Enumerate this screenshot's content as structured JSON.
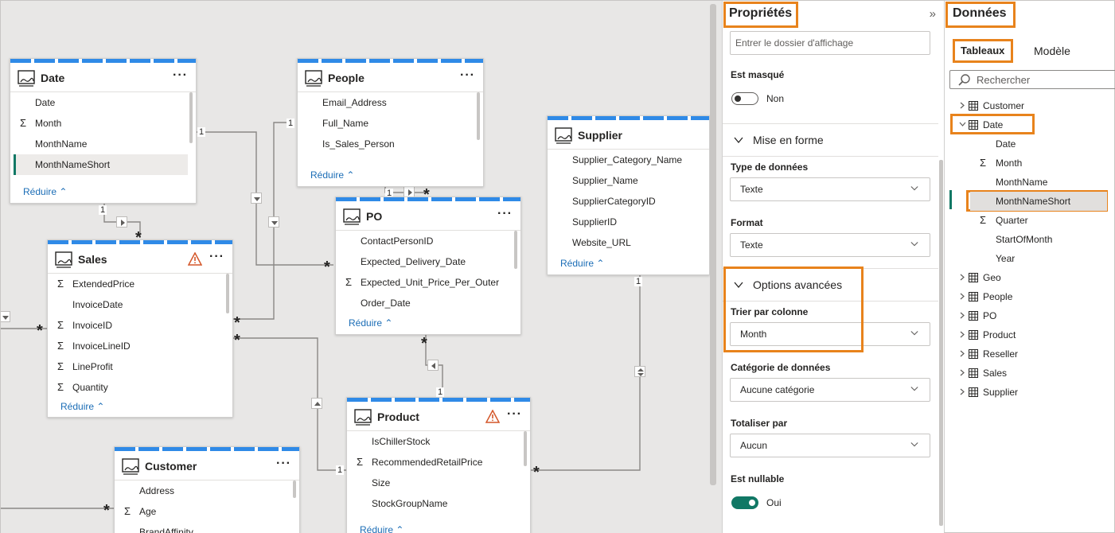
{
  "model": {
    "tables": {
      "date": {
        "name": "Date",
        "fields": [
          {
            "label": "Date",
            "sum": false
          },
          {
            "label": "Month",
            "sum": true
          },
          {
            "label": "MonthName",
            "sum": false
          },
          {
            "label": "MonthNameShort",
            "sum": false,
            "selected": true
          }
        ],
        "reduce": "Réduire"
      },
      "people": {
        "name": "People",
        "fields": [
          {
            "label": "Email_Address",
            "sum": false
          },
          {
            "label": "Full_Name",
            "sum": false
          },
          {
            "label": "Is_Sales_Person",
            "sum": false
          }
        ],
        "reduce": "Réduire"
      },
      "supplier": {
        "name": "Supplier",
        "fields": [
          {
            "label": "Supplier_Category_Name",
            "sum": false
          },
          {
            "label": "Supplier_Name",
            "sum": false
          },
          {
            "label": "SupplierCategoryID",
            "sum": false
          },
          {
            "label": "SupplierID",
            "sum": false
          },
          {
            "label": "Website_URL",
            "sum": false
          }
        ],
        "reduce": "Réduire"
      },
      "sales": {
        "name": "Sales",
        "fields": [
          {
            "label": "ExtendedPrice",
            "sum": true
          },
          {
            "label": "InvoiceDate",
            "sum": false
          },
          {
            "label": "InvoiceID",
            "sum": true
          },
          {
            "label": "InvoiceLineID",
            "sum": true
          },
          {
            "label": "LineProfit",
            "sum": true
          },
          {
            "label": "Quantity",
            "sum": true
          }
        ],
        "reduce": "Réduire"
      },
      "po": {
        "name": "PO",
        "fields": [
          {
            "label": "ContactPersonID",
            "sum": false
          },
          {
            "label": "Expected_Delivery_Date",
            "sum": false
          },
          {
            "label": "Expected_Unit_Price_Per_Outer",
            "sum": true
          },
          {
            "label": "Order_Date",
            "sum": false
          }
        ],
        "reduce": "Réduire"
      },
      "product": {
        "name": "Product",
        "fields": [
          {
            "label": "IsChillerStock",
            "sum": false
          },
          {
            "label": "RecommendedRetailPrice",
            "sum": true
          },
          {
            "label": "Size",
            "sum": false
          },
          {
            "label": "StockGroupName",
            "sum": false
          }
        ],
        "reduce": "Réduire"
      },
      "customer": {
        "name": "Customer",
        "fields": [
          {
            "label": "Address",
            "sum": false
          },
          {
            "label": "Age",
            "sum": true
          },
          {
            "label": "BrandAffinity",
            "sum": false
          }
        ],
        "reduce": ""
      }
    },
    "cardinality": {
      "one": "1",
      "many": "*"
    }
  },
  "properties": {
    "title": "Propriétés",
    "collapse_glyph": "»",
    "display_folder_placeholder": "Entrer le dossier d'affichage",
    "hidden_label": "Est masqué",
    "hidden_value": "Non",
    "formatting_section": "Mise en forme",
    "datatype_label": "Type de données",
    "datatype_value": "Texte",
    "format_label": "Format",
    "format_value": "Texte",
    "advanced_section": "Options avancées",
    "sortby_label": "Trier par colonne",
    "sortby_value": "Month",
    "category_label": "Catégorie de données",
    "category_value": "Aucune catégorie",
    "summarize_label": "Totaliser par",
    "summarize_value": "Aucun",
    "nullable_label": "Est nullable",
    "nullable_value": "Oui"
  },
  "data_pane": {
    "title": "Données",
    "tabs": [
      "Tableaux",
      "Modèle"
    ],
    "search_placeholder": "Rechercher",
    "tree": [
      {
        "label": "Customer",
        "kind": "table",
        "expanded": false
      },
      {
        "label": "Date",
        "kind": "table",
        "expanded": true
      },
      {
        "label": "Date",
        "kind": "field",
        "sum": false
      },
      {
        "label": "Month",
        "kind": "field",
        "sum": true
      },
      {
        "label": "MonthName",
        "kind": "field",
        "sum": false
      },
      {
        "label": "MonthNameShort",
        "kind": "field",
        "sum": false,
        "selected": true
      },
      {
        "label": "Quarter",
        "kind": "field",
        "sum": true
      },
      {
        "label": "StartOfMonth",
        "kind": "field",
        "sum": false
      },
      {
        "label": "Year",
        "kind": "field",
        "sum": false
      },
      {
        "label": "Geo",
        "kind": "table",
        "expanded": false
      },
      {
        "label": "People",
        "kind": "table",
        "expanded": false
      },
      {
        "label": "PO",
        "kind": "table",
        "expanded": false
      },
      {
        "label": "Product",
        "kind": "table",
        "expanded": false
      },
      {
        "label": "Reseller",
        "kind": "table",
        "expanded": false
      },
      {
        "label": "Sales",
        "kind": "table",
        "expanded": false
      },
      {
        "label": "Supplier",
        "kind": "table",
        "expanded": false
      }
    ]
  },
  "colors": {
    "accent": "#117865",
    "highlight": "#e8831c",
    "link": "#1b6db6",
    "header_stripe": "#2f8ae7"
  }
}
